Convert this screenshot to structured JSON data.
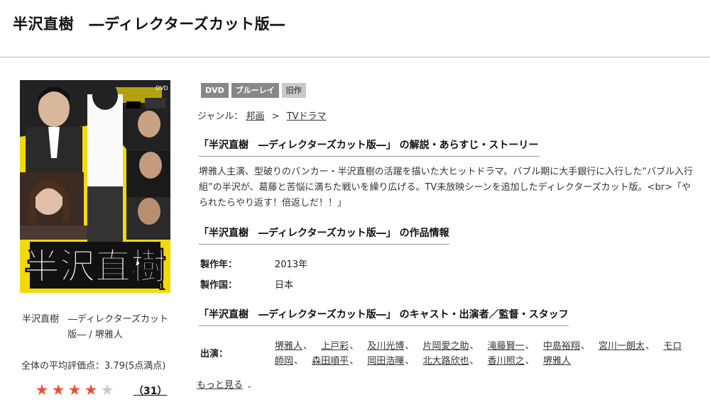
{
  "page": {
    "title": "半沢直樹　―ディレクターズカット版―"
  },
  "poster": {
    "logo_text": "半沢直樹",
    "volume": "1",
    "disc_label": "DVD"
  },
  "sidebar": {
    "caption": "半沢直樹　―ディレクターズカット版― / 堺雅人",
    "avg_rating_text": "全体の平均評価点：3.79(5点満点)",
    "rating_value": 3.79,
    "rating_max": 5,
    "review_count": "（31）"
  },
  "badges": [
    "DVD",
    "ブルーレイ",
    "旧作"
  ],
  "genre": {
    "label": "ジャンル：",
    "items": [
      "邦画",
      "TVドラマ"
    ],
    "separator": ">"
  },
  "sections": {
    "synopsis_heading": "「半沢直樹　―ディレクターズカット版―」 の解説・あらすじ・ストーリー",
    "synopsis_text": "堺雅人主演、型破りのバンカー・半沢直樹の活躍を描いた大ヒットドラマ。バブル期に大手銀行に入行した“バブル入行組”の半沢が、葛藤と苦悩に満ちた戦いを繰り広げる。TV未放映シーンを追加したディレクターズカット版。<br>「やられたらやり返す！倍返しだ！！」",
    "info_heading": "「半沢直樹　―ディレクターズカット版―」 の作品情報",
    "info": [
      {
        "label": "製作年：",
        "value": "2013年"
      },
      {
        "label": "製作国：",
        "value": "日本"
      }
    ],
    "cast_heading": "「半沢直樹　―ディレクターズカット版―」 のキャスト・出演者／監督・スタッフ",
    "cast_label": "出演：",
    "cast": [
      "堺雅人",
      "上戸彩",
      "及川光博",
      "片岡愛之助",
      "滝藤賢一",
      "中島裕翔",
      "宮川一朗太",
      "モロ師岡",
      "森田順平",
      "岡田浩暉",
      "北大路欣也",
      "香川照之",
      "堺雅人"
    ],
    "cast_separator": "、",
    "more_label": "もっと見る"
  },
  "colors": {
    "star": "#e8503a",
    "star_empty": "#c9c9c9",
    "badge": "#888888",
    "badge_light": "#c9c9c9",
    "poster_yellow": "#f2d90a"
  }
}
